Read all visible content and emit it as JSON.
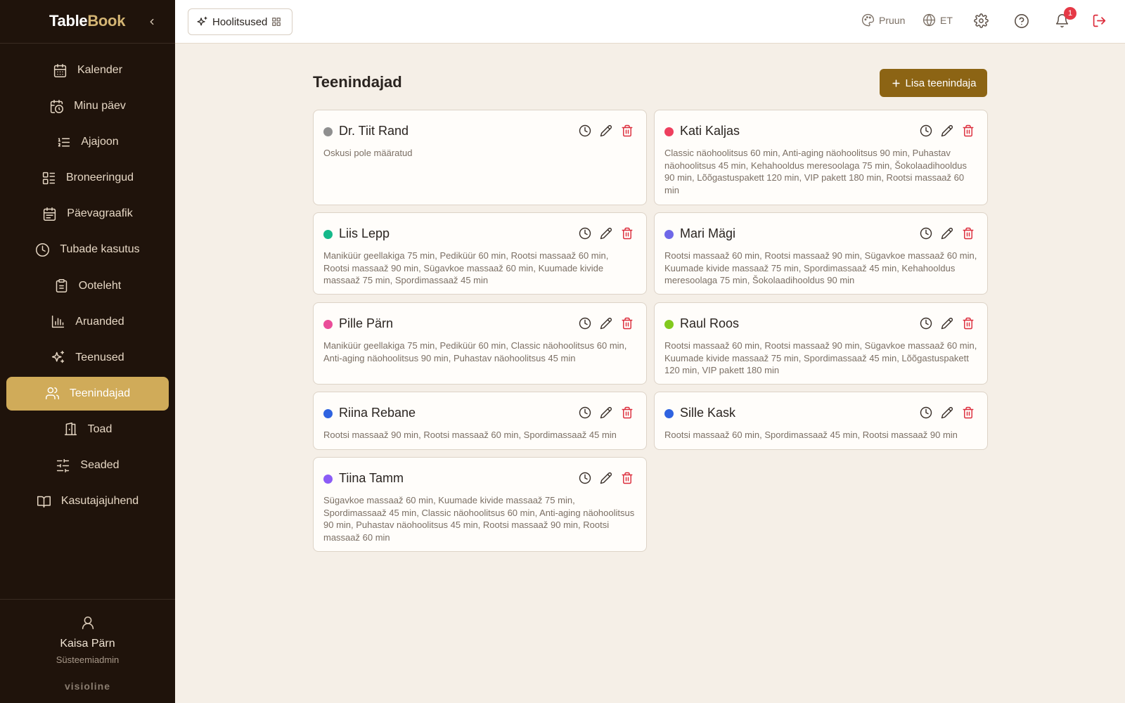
{
  "brand": {
    "part1": "Table",
    "part2": "Book"
  },
  "nav": [
    {
      "label": "Kalender",
      "icon": "calendar-icon",
      "active": false
    },
    {
      "label": "Minu päev",
      "icon": "calendar-clock-icon",
      "active": false
    },
    {
      "label": "Ajajoon",
      "icon": "list-ordered-icon",
      "active": false
    },
    {
      "label": "Broneeringud",
      "icon": "layout-list-icon",
      "active": false
    },
    {
      "label": "Päevagraafik",
      "icon": "calendar-days-icon",
      "active": false
    },
    {
      "label": "Tubade kasutus",
      "icon": "clock-icon",
      "active": false
    },
    {
      "label": "Ooteleht",
      "icon": "clipboard-icon",
      "active": false
    },
    {
      "label": "Aruanded",
      "icon": "bar-chart-icon",
      "active": false
    },
    {
      "label": "Teenused",
      "icon": "sparkles-icon",
      "active": false
    },
    {
      "label": "Teenindajad",
      "icon": "users-icon",
      "active": true
    },
    {
      "label": "Toad",
      "icon": "door-icon",
      "active": false
    },
    {
      "label": "Seaded",
      "icon": "sliders-icon",
      "active": false
    },
    {
      "label": "Kasutajajuhend",
      "icon": "book-icon",
      "active": false
    }
  ],
  "user": {
    "name": "Kaisa Pärn",
    "role": "Süsteemiadmin"
  },
  "footer_brand": "visioline",
  "topbar": {
    "workspace": "Hoolitsused",
    "theme": "Pruun",
    "language": "ET",
    "notifications_count": "1"
  },
  "page": {
    "title": "Teenindajad",
    "add_button": "Lisa teenindaja"
  },
  "colors": {
    "accent": "#8c6414",
    "active_nav": "#d0ab59",
    "sidebar_bg": "#1f130b",
    "delete": "#dc2b3a"
  },
  "staff": [
    {
      "name": "Dr. Tiit Rand",
      "color": "#8f8f8f",
      "skills": "Oskusi pole määratud"
    },
    {
      "name": "Kati Kaljas",
      "color": "#ee3f5e",
      "skills": "Classic näohoolitsus 60 min, Anti-aging näohoolitsus 90 min, Puhastav näohoolitsus 45 min, Kehahooldus meresoolaga 75 min, Šokolaadihooldus 90 min, Lõõgastuspakett 120 min, VIP pakett 180 min, Rootsi massaaž 60 min"
    },
    {
      "name": "Liis Lepp",
      "color": "#15b98a",
      "skills": "Maniküür geellakiga 75 min, Pediküür 60 min, Rootsi massaaž 60 min, Rootsi massaaž 90 min, Sügavkoe massaaž 60 min, Kuumade kivide massaaž 75 min, Spordimassaaž 45 min"
    },
    {
      "name": "Mari Mägi",
      "color": "#6f68e8",
      "skills": "Rootsi massaaž 60 min, Rootsi massaaž 90 min, Sügavkoe massaaž 60 min, Kuumade kivide massaaž 75 min, Spordimassaaž 45 min, Kehahooldus meresoolaga 75 min, Šokolaadihooldus 90 min"
    },
    {
      "name": "Pille Pärn",
      "color": "#ea4d99",
      "skills": "Maniküür geellakiga 75 min, Pediküür 60 min, Classic näohoolitsus 60 min, Anti-aging näohoolitsus 90 min, Puhastav näohoolitsus 45 min"
    },
    {
      "name": "Raul Roos",
      "color": "#82c91e",
      "skills": "Rootsi massaaž 60 min, Rootsi massaaž 90 min, Sügavkoe massaaž 60 min, Kuumade kivide massaaž 75 min, Spordimassaaž 45 min, Lõõgastuspakett 120 min, VIP pakett 180 min"
    },
    {
      "name": "Riina Rebane",
      "color": "#2f63e0",
      "skills": "Rootsi massaaž 90 min, Rootsi massaaž 60 min, Spordimassaaž 45 min"
    },
    {
      "name": "Sille Kask",
      "color": "#2f63e0",
      "skills": "Rootsi massaaž 60 min, Spordimassaaž 45 min, Rootsi massaaž 90 min"
    },
    {
      "name": "Tiina Tamm",
      "color": "#8b5cf6",
      "skills": "Sügavkoe massaaž 60 min, Kuumade kivide massaaž 75 min, Spordimassaaž 45 min, Classic näohoolitsus 60 min, Anti-aging näohoolitsus 90 min, Puhastav näohoolitsus 45 min, Rootsi massaaž 90 min, Rootsi massaaž 60 min"
    }
  ]
}
